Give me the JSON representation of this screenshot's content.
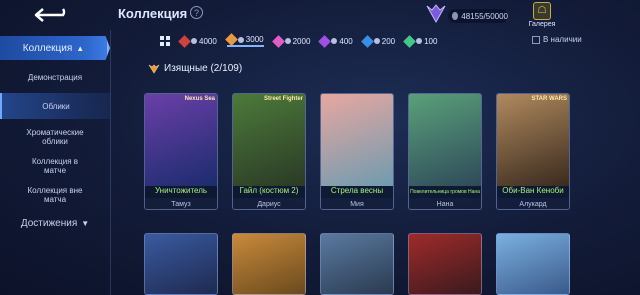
{
  "header": {
    "title": "Коллекция",
    "help": "?",
    "points": "48155/50000",
    "gallery_label": "Галерея"
  },
  "sidebar": {
    "header": "Коллекция",
    "items": [
      {
        "label": "Демонстрация"
      },
      {
        "label": "Облики"
      },
      {
        "label": "Хроматические облики"
      },
      {
        "label": "Коллекция в матче"
      },
      {
        "label": "Коллекция вне матча"
      }
    ],
    "footer": "Достижения"
  },
  "filters": [
    {
      "value": "4000",
      "color": "#d2423b"
    },
    {
      "value": "3000",
      "color": "#e89a3c"
    },
    {
      "value": "2000",
      "color": "#e45cc4"
    },
    {
      "value": "400",
      "color": "#a54ee6"
    },
    {
      "value": "200",
      "color": "#3a8ee8"
    },
    {
      "value": "100",
      "color": "#3fc98a"
    }
  ],
  "owned_label": "В наличии",
  "section": {
    "title": "Изящные (2/109)"
  },
  "cards": [
    {
      "skin": "Уничтожитель",
      "hero": "Тамуз",
      "tag": "Nexus Sea",
      "bg1": "#6b3fa8",
      "bg2": "#1b2c6e"
    },
    {
      "skin": "Гайл (костюм 2)",
      "hero": "Дариус",
      "tag": "Street Fighter",
      "bg1": "#4c7a3a",
      "bg2": "#2b3a26"
    },
    {
      "skin": "Стрела весны",
      "hero": "Мия",
      "tag": "",
      "bg1": "#e8a7a0",
      "bg2": "#6f9bb0"
    },
    {
      "skin": "Повелительница громов Нана",
      "hero": "Нана",
      "tag": "",
      "bg1": "#5aa07a",
      "bg2": "#2e4a5a"
    },
    {
      "skin": "Оби-Ван Кеноби",
      "hero": "Алукард",
      "tag": "STAR WARS",
      "bg1": "#b08a5e",
      "bg2": "#3a2a1e"
    }
  ],
  "bottom_cards": [
    {
      "bg1": "#3a5aa0",
      "bg2": "#1e2a50"
    },
    {
      "bg1": "#c98a3a",
      "bg2": "#6a4a1e"
    },
    {
      "bg1": "#5a7aa0",
      "bg2": "#2a3a50"
    },
    {
      "bg1": "#a02a2a",
      "bg2": "#3a1a1e"
    },
    {
      "bg1": "#7ab0e0",
      "bg2": "#3a5a8a"
    }
  ]
}
